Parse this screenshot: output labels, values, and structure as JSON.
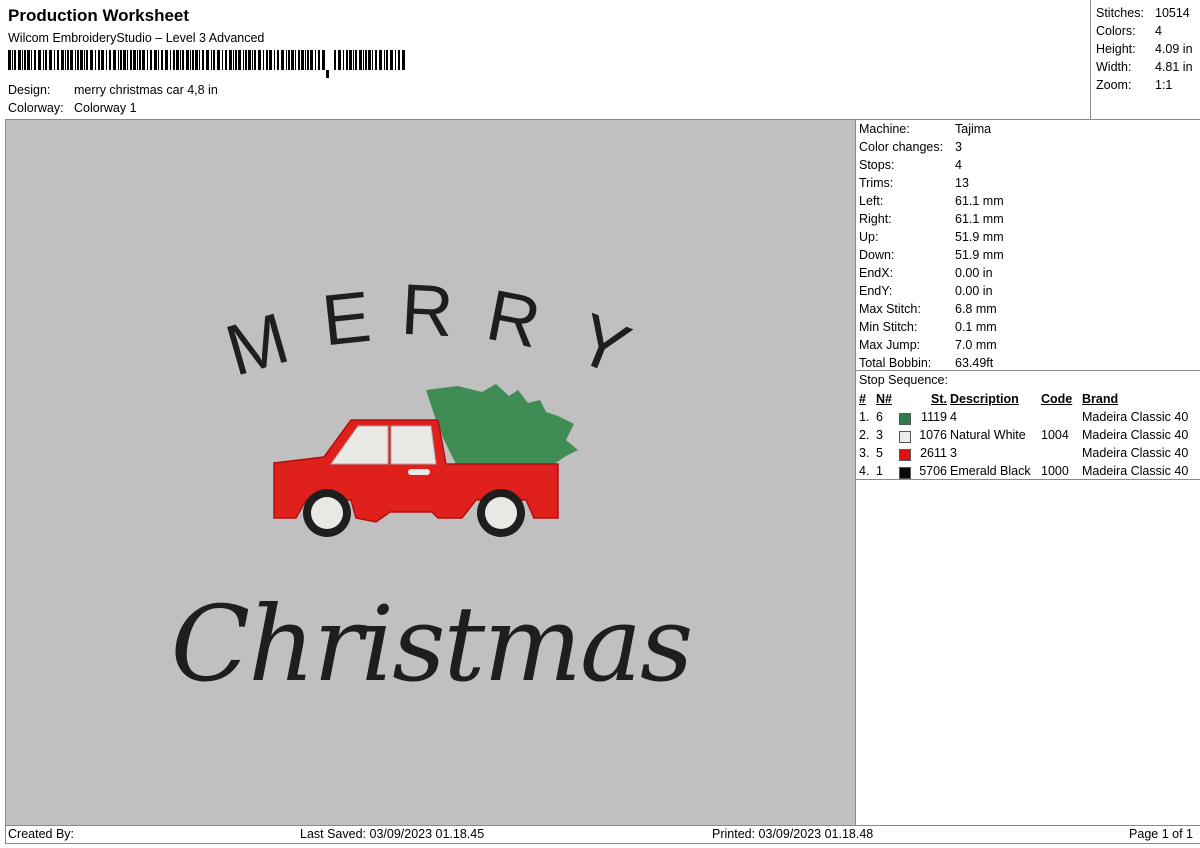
{
  "header": {
    "title": "Production Worksheet",
    "subtitle": "Wilcom EmbroideryStudio – Level 3 Advanced",
    "design_label": "Design:",
    "design_value": "merry christmas car 4,8 in",
    "colorway_label": "Colorway:",
    "colorway_value": "Colorway 1"
  },
  "stats": {
    "stitches_label": "Stitches:",
    "stitches": "10514",
    "colors_label": "Colors:",
    "colors": "4",
    "height_label": "Height:",
    "height": "4.09 in",
    "width_label": "Width:",
    "width": "4.81 in",
    "zoom_label": "Zoom:",
    "zoom": "1:1"
  },
  "machine": {
    "rows": [
      {
        "label": "Machine:",
        "value": "Tajima"
      },
      {
        "label": "Color changes:",
        "value": "3"
      },
      {
        "label": "Stops:",
        "value": "4"
      },
      {
        "label": "Trims:",
        "value": "13"
      },
      {
        "label": "Left:",
        "value": "61.1 mm"
      },
      {
        "label": "Right:",
        "value": "61.1 mm"
      },
      {
        "label": "Up:",
        "value": "51.9 mm"
      },
      {
        "label": "Down:",
        "value": "51.9 mm"
      },
      {
        "label": "EndX:",
        "value": "0.00 in"
      },
      {
        "label": "EndY:",
        "value": "0.00 in"
      },
      {
        "label": "Max Stitch:",
        "value": "6.8 mm"
      },
      {
        "label": "Min Stitch:",
        "value": "0.1 mm"
      },
      {
        "label": "Max Jump:",
        "value": "7.0 mm"
      },
      {
        "label": "Total Bobbin:",
        "value": "63.49ft"
      }
    ]
  },
  "stop_sequence": {
    "title": "Stop Sequence:",
    "headers": {
      "num": "#",
      "n": "N#",
      "st": "St.",
      "description": "Description",
      "code": "Code",
      "brand": "Brand"
    },
    "rows": [
      {
        "num": "1.",
        "n": "6",
        "color": "#2e7d4f",
        "st": "1119",
        "description": "4",
        "code": "",
        "brand": "Madeira Classic 40"
      },
      {
        "num": "2.",
        "n": "3",
        "color": "#ececf0",
        "st": "1076",
        "description": "Natural White",
        "code": "1004",
        "brand": "Madeira Classic 40"
      },
      {
        "num": "3.",
        "n": "5",
        "color": "#e01010",
        "st": "2611",
        "description": "3",
        "code": "",
        "brand": "Madeira Classic 40"
      },
      {
        "num": "4.",
        "n": "1",
        "color": "#0a0a0a",
        "st": "5706",
        "description": "Emerald Black",
        "code": "1000",
        "brand": "Madeira Classic 40"
      }
    ]
  },
  "artwork": {
    "top_text": "MERRY",
    "bottom_text": "Christmas",
    "colors": {
      "canvas": "#c0c0c0",
      "black": "#1e1e1e",
      "red": "#e0201c",
      "green": "#3f8d55",
      "white": "#e8e8e4"
    }
  },
  "footer": {
    "created_by": "Created By:",
    "last_saved": "Last Saved: 03/09/2023 01.18.45",
    "printed": "Printed: 03/09/2023 01.18.48",
    "page": "Page 1 of 1"
  }
}
